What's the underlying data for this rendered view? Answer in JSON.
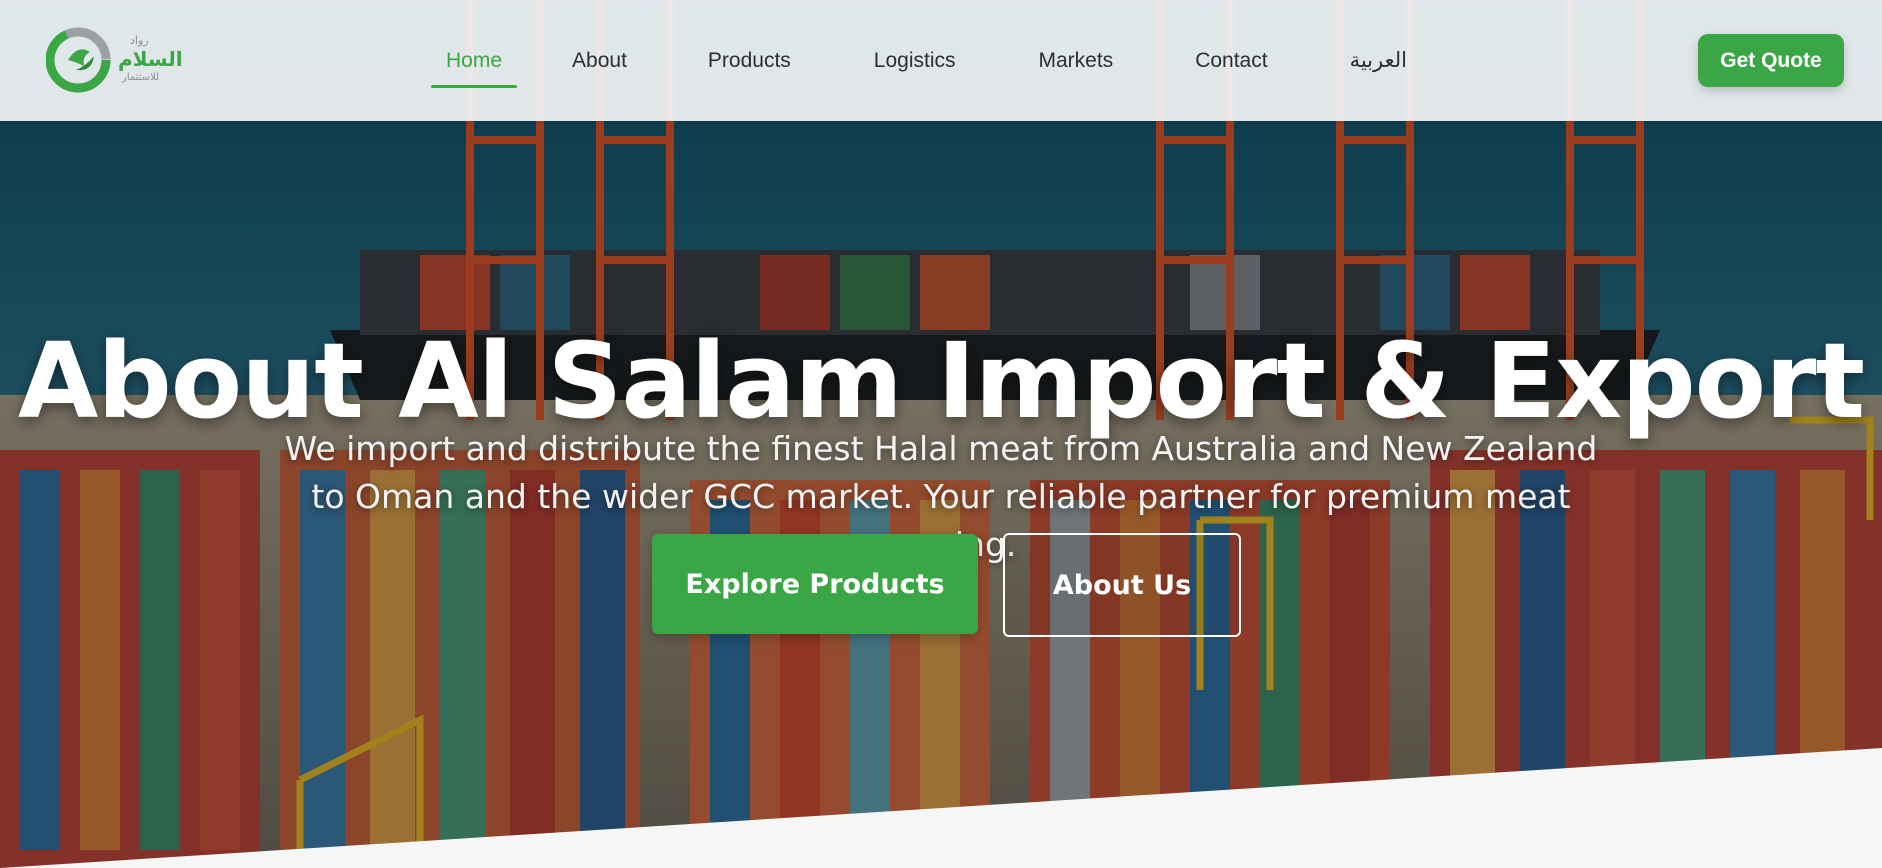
{
  "header": {
    "logo_text_ar": "رواد السلام للاستثمار",
    "nav": [
      {
        "label": "Home",
        "active": true
      },
      {
        "label": "About",
        "active": false
      },
      {
        "label": "Products",
        "active": false
      },
      {
        "label": "Logistics",
        "active": false
      },
      {
        "label": "Markets",
        "active": false
      },
      {
        "label": "Contact",
        "active": false
      },
      {
        "label": "العربية",
        "active": false
      }
    ],
    "cta_label": "Get Quote"
  },
  "hero": {
    "title": "About Al Salam Import & Export",
    "subtitle": "We import and distribute the finest Halal meat from Australia and New Zealand to Oman and the wider GCC market. Your reliable partner for premium meat sourcing.",
    "primary_button": "Explore Products",
    "secondary_button": "About Us",
    "background": "port-container-terminal-image"
  },
  "colors": {
    "accent": "#3ba646",
    "header_bg": "#f1f4f5",
    "nav_text": "#2a2f33",
    "sea": "#1d5a73",
    "footer_bg": "#f5f7f6"
  }
}
